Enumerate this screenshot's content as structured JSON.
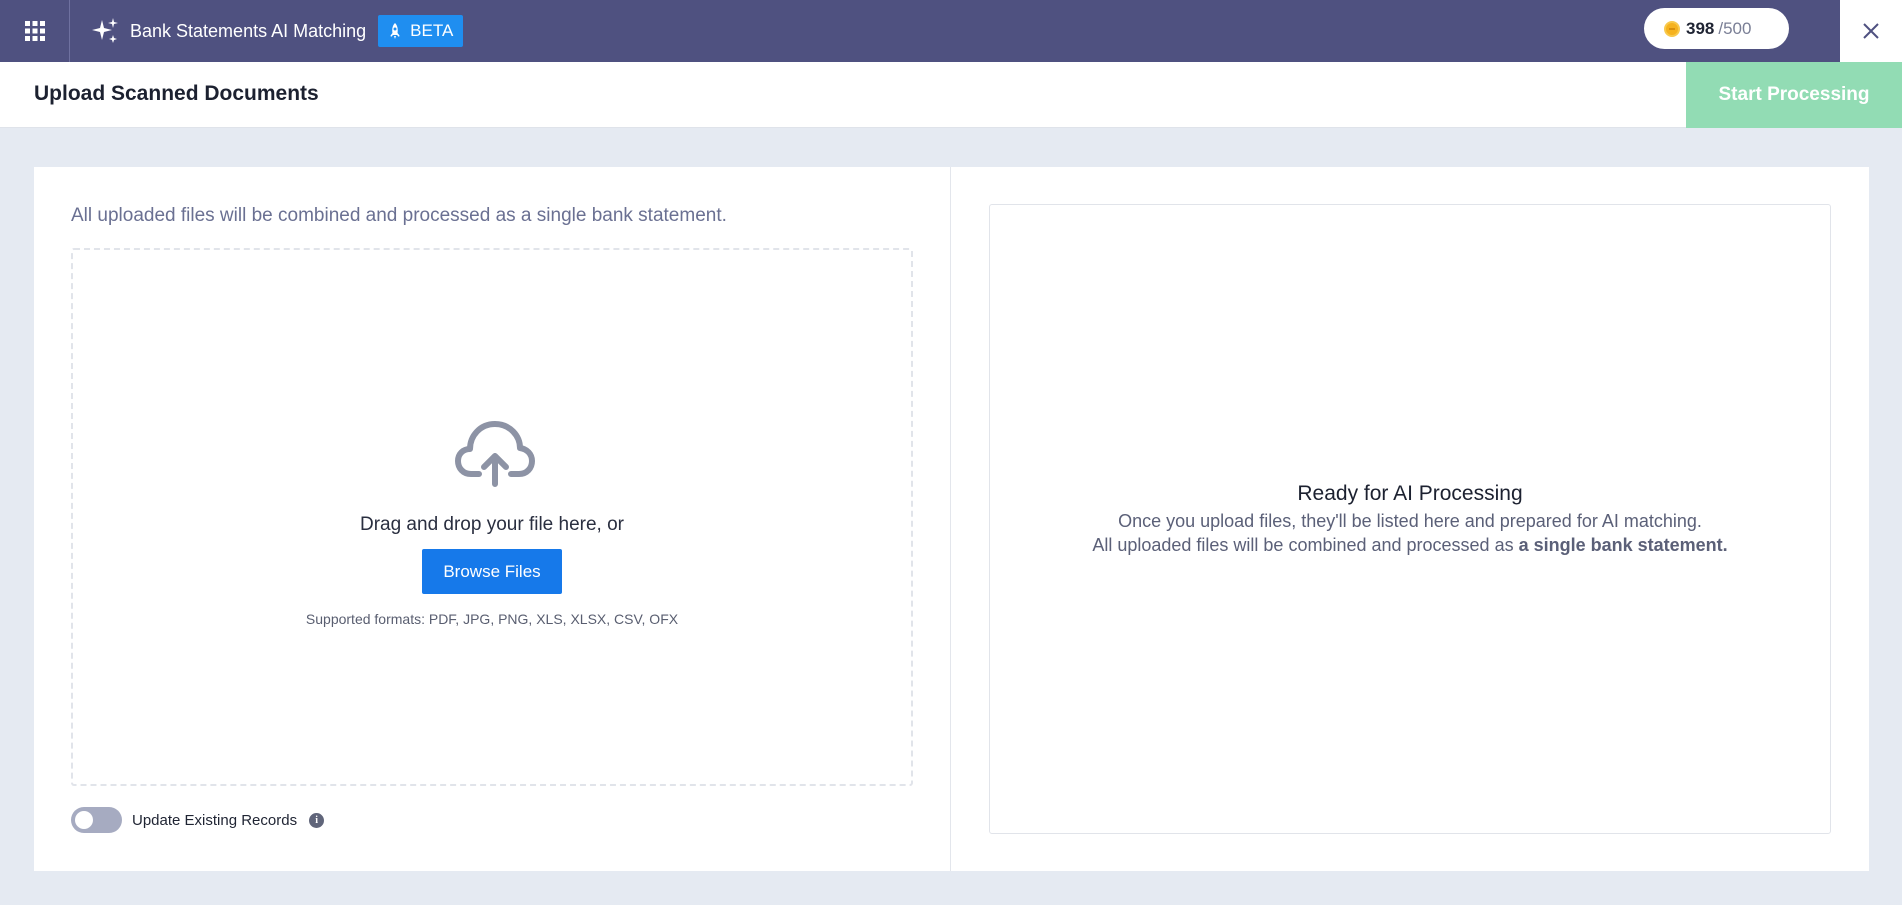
{
  "topbar": {
    "app_title": "Bank Statements AI Matching",
    "beta_label": "BETA",
    "credits_used": "398",
    "credits_total": "/500"
  },
  "header": {
    "page_title": "Upload Scanned Documents",
    "start_label": "Start Processing"
  },
  "upload": {
    "info_text": "All uploaded files will be combined and processed as a single bank statement.",
    "drag_text": "Drag and drop your file here, or",
    "browse_label": "Browse Files",
    "formats_text": "Supported formats: PDF, JPG, PNG, XLS, XLSX, CSV, OFX",
    "toggle_label": "Update Existing Records",
    "toggle_on": false
  },
  "ready": {
    "title": "Ready for AI Processing",
    "line1": "Once you upload files, they'll be listed here and prepared for AI matching.",
    "line2_prefix": "All uploaded files will be combined and processed as ",
    "line2_bold": "a single bank statement."
  },
  "icons": {
    "apps": "apps-grid-icon",
    "sparkle": "sparkle-icon",
    "rocket": "rocket-icon",
    "coin": "coin-icon",
    "close": "close-icon",
    "upload": "cloud-upload-icon",
    "info": "info-icon"
  },
  "colors": {
    "topbar": "#4f5180",
    "beta": "#1f8ef0",
    "start_button": "#92dcb4",
    "browse_button": "#1679ea",
    "page_bg": "#e5eaf2"
  }
}
